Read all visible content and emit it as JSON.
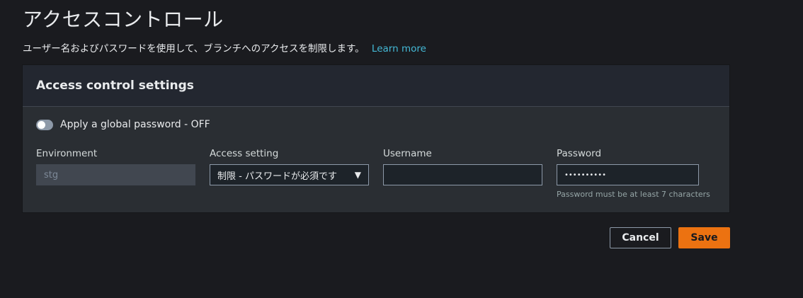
{
  "page": {
    "title": "アクセスコントロール",
    "description": "ユーザー名およびパスワードを使用して、ブランチへのアクセスを制限します。",
    "learn_more": "Learn more"
  },
  "panel": {
    "title": "Access control settings",
    "toggle": {
      "label": "Apply a global password - OFF",
      "enabled": false
    },
    "fields": {
      "environment": {
        "label": "Environment",
        "value": "stg",
        "disabled": true
      },
      "access_setting": {
        "label": "Access setting",
        "value": "制限 - パスワードが必須です"
      },
      "username": {
        "label": "Username",
        "value": ""
      },
      "password": {
        "label": "Password",
        "value": "••••••••••",
        "hint": "Password must be at least 7 characters"
      }
    }
  },
  "actions": {
    "cancel_label": "Cancel",
    "save_label": "Save"
  },
  "colors": {
    "background": "#1a1b1f",
    "panel": "#2a2e33",
    "link": "#44b9d6",
    "primary": "#ec7211"
  }
}
